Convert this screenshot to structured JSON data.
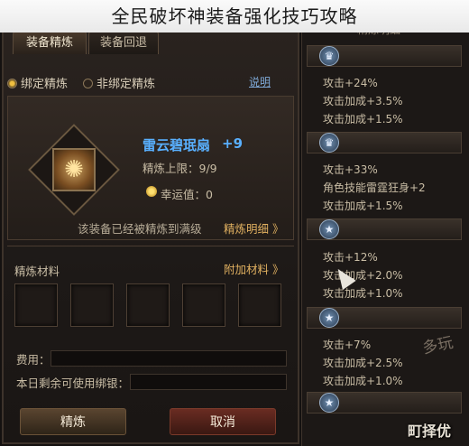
{
  "title": "全民破坏神装备强化技巧攻略",
  "tabs": [
    "装备精炼",
    "装备回退"
  ],
  "radio": {
    "bound": "绑定精炼",
    "unbound": "非绑定精炼"
  },
  "explain_link": "说明",
  "item": {
    "name": "雷云碧珉扇",
    "level": "+9",
    "refine_max": "精炼上限：9/9",
    "luck": "幸运值：0",
    "icon": "fan-icon"
  },
  "maxed_msg": "该装备已经被精炼到满级",
  "detail_link": "精炼明细 》",
  "materials": {
    "label": "精炼材料",
    "extra": "附加材料 》"
  },
  "fields": {
    "fee": "费用：",
    "silver": "本日剩余可使用绑银："
  },
  "buttons": {
    "refine": "精炼",
    "cancel": "取消"
  },
  "right_panel": {
    "header": "精炼明细",
    "groups": [
      {
        "icon": "crown-icon",
        "lines": [
          "攻击+24%",
          "攻击加成+3.5%",
          "攻击加成+1.5%"
        ]
      },
      {
        "icon": "crown-icon",
        "lines": [
          "攻击+33%",
          "角色技能雷霆狂身+2",
          "攻击加成+1.5%"
        ]
      },
      {
        "icon": "star-icon",
        "lines": [
          "攻击+12%",
          "攻击加成+2.0%",
          "攻击加成+1.0%"
        ]
      },
      {
        "icon": "star-icon",
        "lines": [
          "攻击+7%",
          "攻击加成+2.5%",
          "攻击加成+1.0%"
        ]
      }
    ]
  },
  "watermarks": {
    "game": "多玩",
    "site": "町择优"
  }
}
